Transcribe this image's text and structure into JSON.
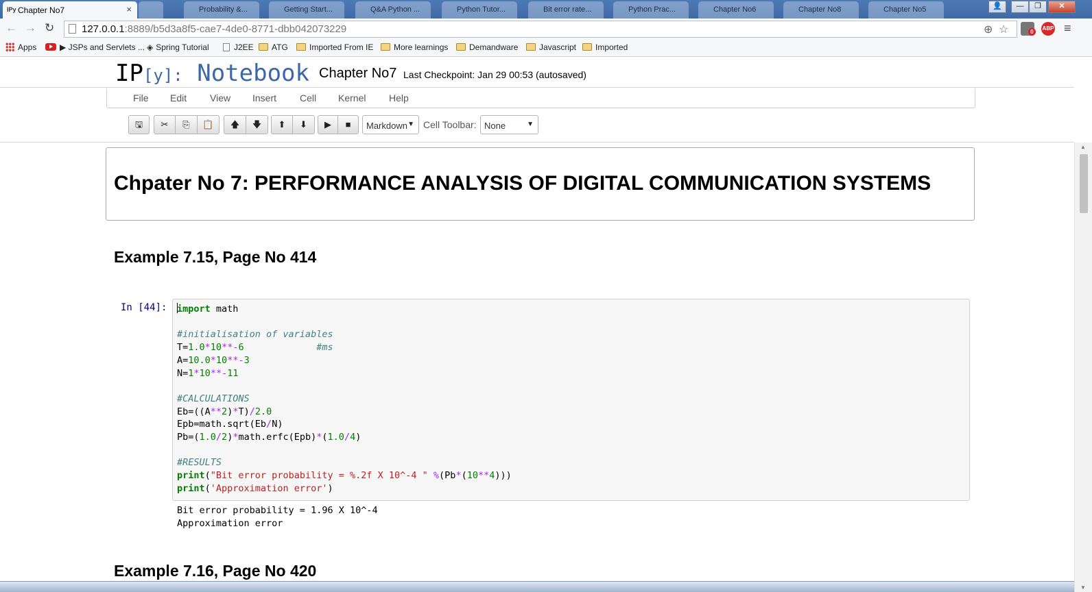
{
  "browser": {
    "active_tab": {
      "favicon": "IPy",
      "title": "Chapter No7"
    },
    "background_tabs": [
      "Probability &...",
      "Getting Start...",
      "Q&A Python ...",
      "Python Tutor...",
      "Bit error rate...",
      "Python Prac...",
      "Chapter No6",
      "Chapter No8",
      "Chapter No5"
    ],
    "url_host": "127.0.0.1",
    "url_rest": ":8889/b5d3a8f5-cae7-4de0-8771-dbb042073229",
    "extension_badge": "0",
    "abp_label": "ABP",
    "bookmarks": [
      "Apps",
      "▶ JSPs and Servlets ...",
      "Spring Tutorial",
      "J2EE",
      "ATG",
      "Imported From IE",
      "More learnings",
      "Demandware",
      "Javascript",
      "Imported"
    ]
  },
  "notebook": {
    "logo_ip": "IP",
    "logo_y": "[y]:",
    "logo_nb": "Notebook",
    "name": "Chapter No7",
    "checkpoint": "Last Checkpoint: Jan 29 00:53 (autosaved)",
    "menu": [
      "File",
      "Edit",
      "View",
      "Insert",
      "Cell",
      "Kernel",
      "Help"
    ],
    "cell_type": "Markdown",
    "cell_toolbar_label": "Cell Toolbar:",
    "cell_toolbar_value": "None"
  },
  "content": {
    "h1": "Chpater No 7: PERFORMANCE ANALYSIS OF DIGITAL COMMUNICATION SYSTEMS",
    "example1": "Example 7.15, Page No 414",
    "prompt": "In [44]:",
    "code_lines": [
      "import math",
      "",
      "#initialisation of variables",
      "T=1.0*10**-6             #ms",
      "A=10.0*10**-3",
      "N=1*10**-11",
      "",
      "#CALCULATIONS",
      "Eb=((A**2)*T)/2.0",
      "Epb=math.sqrt(Eb/N)",
      "Pb=(1.0/2)*math.erfc(Epb)*(1.0/4)",
      "",
      "#RESULTS",
      "print(\"Bit error probability = %.2f X 10^-4 \" %(Pb*(10**4)))",
      "print('Approximation error')"
    ],
    "output_lines": [
      "Bit error probability = 1.96 X 10^-4",
      "Approximation error"
    ],
    "example2": "Example 7.16, Page No 420"
  }
}
